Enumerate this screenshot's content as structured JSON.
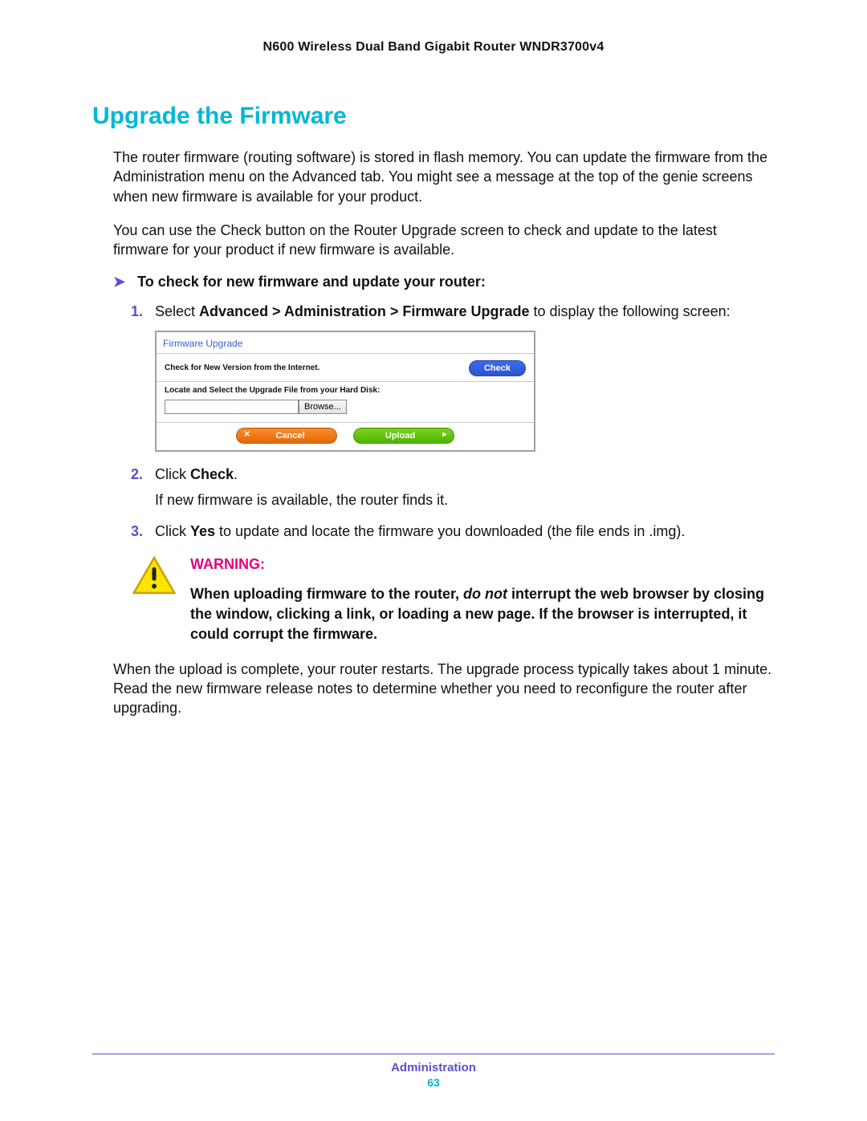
{
  "header": {
    "title": "N600 Wireless Dual Band Gigabit Router WNDR3700v4"
  },
  "section": {
    "title": "Upgrade the Firmware"
  },
  "para1": "The router firmware (routing software) is stored in flash memory. You can update the firmware from the Administration menu on the Advanced tab. You might see a message at the top of the genie screens when new firmware is available for your product.",
  "para2": "You can use the Check button on the Router Upgrade screen to check and update to the latest firmware for your product if new firmware is available.",
  "procedure": {
    "heading": "To check for new firmware and update your router:",
    "step1_prefix": "Select ",
    "step1_bold": "Advanced > Administration > Firmware Upgrade",
    "step1_suffix": " to display the following screen:",
    "step2_prefix": "Click ",
    "step2_bold": "Check",
    "step2_suffix": ".",
    "step2_line2": "If new firmware is available, the router finds it.",
    "step3_prefix": "Click ",
    "step3_bold": "Yes",
    "step3_suffix": " to update and locate the firmware you downloaded (the file ends in .img)."
  },
  "fw_box": {
    "title": "Firmware Upgrade",
    "check_label": "Check for New Version from the Internet.",
    "check_btn": "Check",
    "locate_label": "Locate and Select the Upgrade File from your Hard Disk:",
    "browse_btn": "Browse...",
    "cancel_btn": "Cancel",
    "upload_btn": "Upload"
  },
  "warning": {
    "label": "WARNING:",
    "line1_a": "When uploading firmware to the router, ",
    "line1_em": "do not",
    "line1_b": " interrupt the web browser by closing the window, clicking a link, or loading a new page. If the browser is interrupted, it could corrupt the firmware."
  },
  "para3": "When the upload is complete, your router restarts. The upgrade process typically takes about 1 minute. Read the new firmware release notes to determine whether you need to reconfigure the router after upgrading.",
  "footer": {
    "section": "Administration",
    "page": "63"
  }
}
